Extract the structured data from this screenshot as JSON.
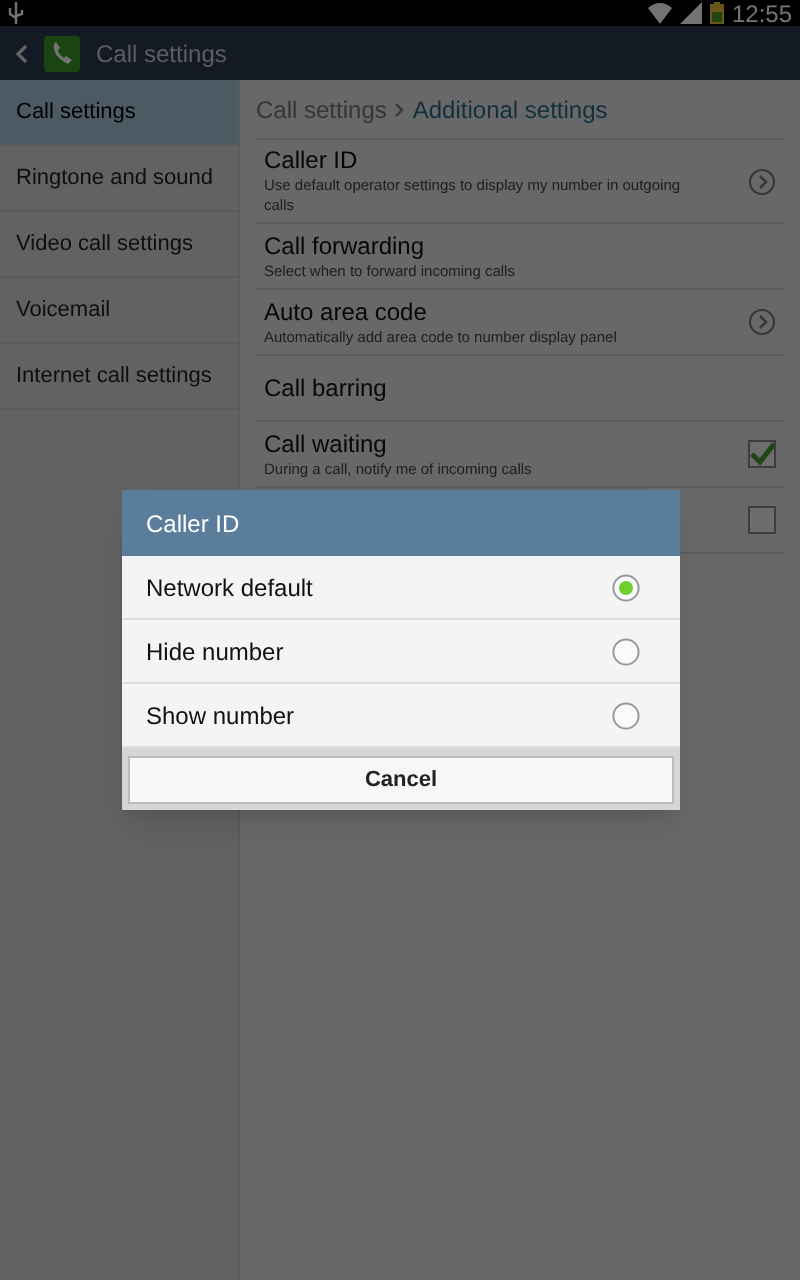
{
  "status_bar": {
    "time": "12:55"
  },
  "action_bar": {
    "title": "Call settings"
  },
  "sidebar": {
    "items": [
      {
        "label": "Call settings",
        "selected": true
      },
      {
        "label": "Ringtone and sound",
        "selected": false
      },
      {
        "label": "Video call settings",
        "selected": false
      },
      {
        "label": "Voicemail",
        "selected": false
      },
      {
        "label": "Internet call settings",
        "selected": false
      }
    ]
  },
  "breadcrumb": {
    "parent": "Call settings",
    "current": "Additional settings"
  },
  "settings": [
    {
      "kind": "link",
      "title": "Caller ID",
      "summary": "Use default operator settings to display my number in outgoing calls"
    },
    {
      "kind": "plain",
      "title": "Call forwarding",
      "summary": "Select when to forward incoming calls"
    },
    {
      "kind": "link",
      "title": "Auto area code",
      "summary": "Automatically add area code to number display panel"
    },
    {
      "kind": "plain",
      "title": "Call barring"
    },
    {
      "kind": "checkbox",
      "title": "Call waiting",
      "summary": "During a call, notify me of incoming calls",
      "checked": true
    },
    {
      "kind": "checkbox",
      "checked": false
    }
  ],
  "dialog": {
    "title": "Caller ID",
    "options": [
      {
        "label": "Network default",
        "selected": true
      },
      {
        "label": "Hide number",
        "selected": false
      },
      {
        "label": "Show number",
        "selected": false
      }
    ],
    "button": "Cancel"
  }
}
